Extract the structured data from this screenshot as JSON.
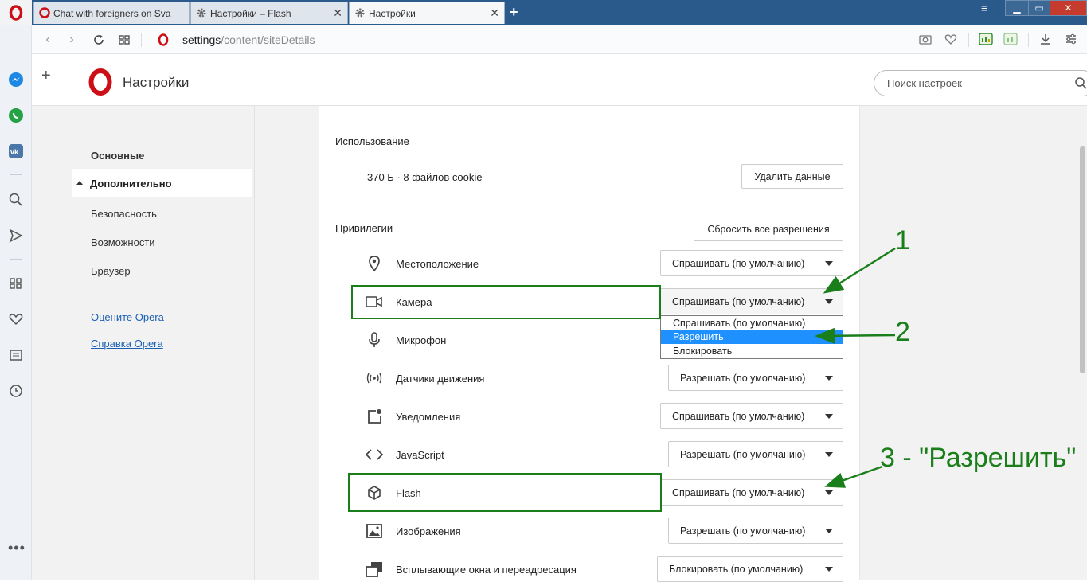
{
  "tabs": [
    {
      "label": "Chat with foreigners on Sva",
      "active": false
    },
    {
      "label": "Настройки – Flash",
      "active": false
    },
    {
      "label": "Настройки",
      "active": true
    }
  ],
  "window": {
    "minimize": "▁",
    "restore": "▭",
    "close": "✕"
  },
  "address": {
    "url_prefix": "settings",
    "url_rest": "/content/siteDetails"
  },
  "header": {
    "title": "Настройки",
    "search_placeholder": "Поиск настроек"
  },
  "nav": {
    "basic": "Основные",
    "advanced": "Дополнительно",
    "items": [
      "Безопасность",
      "Возможности",
      "Браузер"
    ],
    "links": [
      "Оцените Opera",
      "Справка Opera"
    ]
  },
  "usage": {
    "heading": "Использование",
    "info": "370 Б · 8 файлов cookie",
    "delete_button": "Удалить данные"
  },
  "permissions": {
    "heading": "Привилегии",
    "reset_button": "Сбросить все разрешения",
    "rows": [
      {
        "label": "Местоположение",
        "value": "Спрашивать (по умолчанию)",
        "icon": "location-icon"
      },
      {
        "label": "Камера",
        "value": "Спрашивать (по умолчанию)",
        "icon": "camera-icon"
      },
      {
        "label": "Микрофон",
        "value": "",
        "icon": "microphone-icon"
      },
      {
        "label": "Датчики движения",
        "value": "Разрешать (по умолчанию)",
        "icon": "motion-sensors-icon"
      },
      {
        "label": "Уведомления",
        "value": "Спрашивать (по умолчанию)",
        "icon": "notifications-icon"
      },
      {
        "label": "JavaScript",
        "value": "Разрешать (по умолчанию)",
        "icon": "code-icon"
      },
      {
        "label": "Flash",
        "value": "Спрашивать (по умолчанию)",
        "icon": "flash-cube-icon"
      },
      {
        "label": "Изображения",
        "value": "Разрешать (по умолчанию)",
        "icon": "image-icon"
      },
      {
        "label": "Всплывающие окна и переадресация",
        "value": "Блокировать (по умолчанию)",
        "icon": "popup-icon"
      }
    ]
  },
  "dropdown_options": [
    "Спрашивать (по умолчанию)",
    "Разрешить",
    "Блокировать"
  ],
  "annotations": {
    "one": "1",
    "two": "2",
    "three": "3 - \"Разрешить\""
  },
  "colors": {
    "annotation": "#1a7f1a",
    "opera_red": "#cc0f16",
    "highlight": "#1e90ff",
    "link": "#1a5fb4"
  }
}
